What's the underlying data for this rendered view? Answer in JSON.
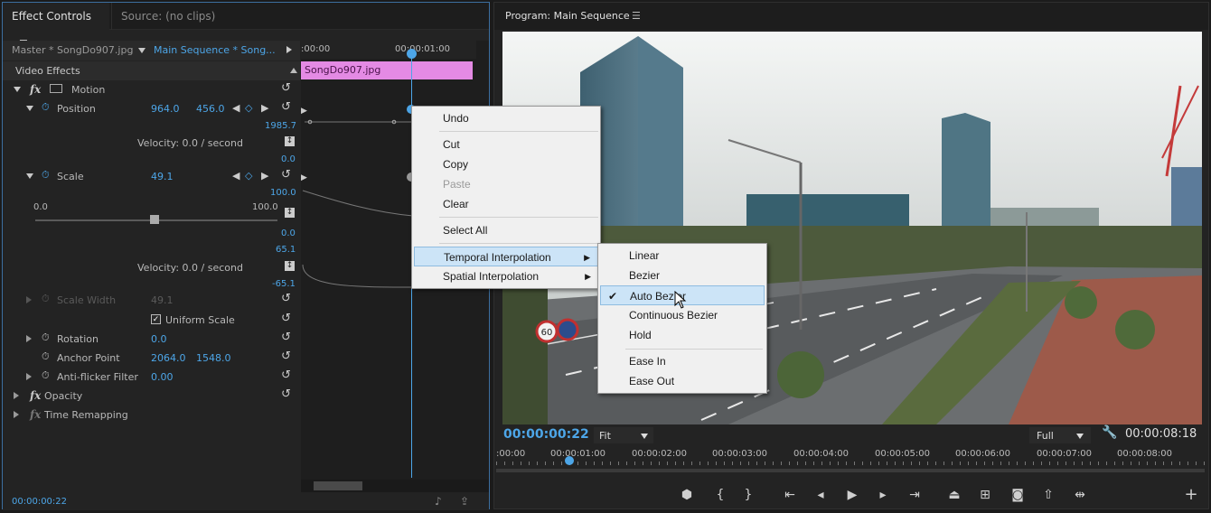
{
  "effect_controls": {
    "tab_label": "Effect Controls",
    "source_tab_label": "Source: (no clips)",
    "master_label": "Master * SongDo907.jpg",
    "sequence_label": "Main Sequence * Song...",
    "section_label": "Video Effects",
    "ruler": {
      "start": ":00:00",
      "mark": "00:00:01:00"
    },
    "clip_name": "SongDo907.jpg",
    "motion_label": "Motion",
    "position": {
      "label": "Position",
      "x": "964.0",
      "y": "456.0",
      "graph_top": "1985.7",
      "graph_bottom": "0.0",
      "velocity": "Velocity: 0.0 / second"
    },
    "scale": {
      "label": "Scale",
      "value": "49.1",
      "graph_top": "100.0",
      "graph_mid": "0.0",
      "slider_min": "0.0",
      "slider_max": "100.0",
      "slider_fraction": 0.491,
      "vel_top": "65.1",
      "vel_bottom": "-65.1",
      "velocity": "Velocity: 0.0 / second"
    },
    "scale_width": {
      "label": "Scale Width",
      "value": "49.1"
    },
    "uniform_scale": {
      "label": "Uniform Scale",
      "checked": true
    },
    "rotation": {
      "label": "Rotation",
      "value": "0.0"
    },
    "anchor_point": {
      "label": "Anchor Point",
      "x": "2064.0",
      "y": "1548.0"
    },
    "anti_flicker": {
      "label": "Anti-flicker Filter",
      "value": "0.00"
    },
    "opacity_label": "Opacity",
    "time_remapping_label": "Time Remapping",
    "timecode": "00:00:00:22"
  },
  "context_menu": {
    "items": [
      "Undo",
      "Cut",
      "Copy",
      "Paste",
      "Clear",
      "Select All",
      "Temporal Interpolation",
      "Spatial Interpolation"
    ],
    "disabled": [
      "Paste"
    ],
    "highlighted": "Temporal Interpolation"
  },
  "submenu": {
    "items": [
      "Linear",
      "Bezier",
      "Auto Bezier",
      "Continuous Bezier",
      "Hold",
      "Ease In",
      "Ease Out"
    ],
    "checked": "Auto Bezier"
  },
  "program": {
    "title": "Program: Main Sequence",
    "timecode": "00:00:00:22",
    "fit_label": "Fit",
    "quality_label": "Full",
    "duration": "00:00:08:18",
    "ruler_labels": [
      ":00:00",
      "00:00:01:00",
      "00:00:02:00",
      "00:00:03:00",
      "00:00:04:00",
      "00:00:05:00",
      "00:00:06:00",
      "00:00:07:00",
      "00:00:08:00"
    ],
    "road_signs": [
      "60"
    ]
  },
  "colors": {
    "accent": "#4da6e8",
    "clip": "#e48ae4",
    "panel": "#232323",
    "menu_highlight": "#cce4f7"
  }
}
